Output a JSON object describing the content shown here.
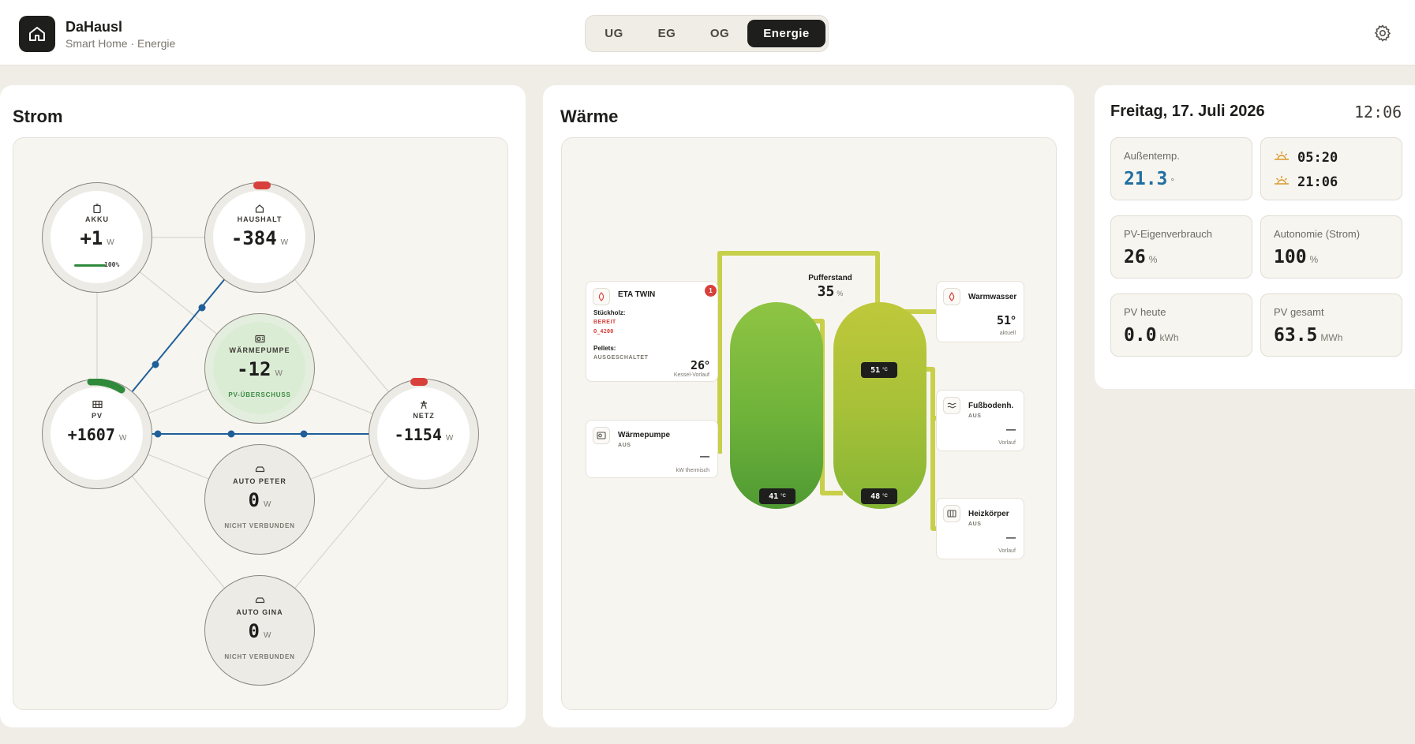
{
  "app": {
    "title": "DaHausl",
    "subtitle": "Smart Home · Energie",
    "logo_icon": "home-icon"
  },
  "nav": {
    "tabs": [
      "UG",
      "EG",
      "OG",
      "Energie"
    ],
    "active": "Energie"
  },
  "strom": {
    "title": "Strom",
    "nodes": {
      "akku": {
        "label": "AKKU",
        "value": "+1",
        "unit": "W",
        "soc": "100%",
        "icon": "battery-icon"
      },
      "haushalt": {
        "label": "HAUSHALT",
        "value": "-384",
        "unit": "W",
        "icon": "house-icon"
      },
      "waermepumpe": {
        "label": "WÄRMEPUMPE",
        "value": "-12",
        "unit": "W",
        "status": "PV-ÜBERSCHUSS",
        "icon": "heat-pump-icon"
      },
      "pv": {
        "label": "PV",
        "value": "+1607",
        "unit": "W",
        "icon": "solar-panel-icon"
      },
      "netz": {
        "label": "NETZ",
        "value": "-1154",
        "unit": "W",
        "icon": "grid-tower-icon"
      },
      "auto_peter": {
        "label": "AUTO PETER",
        "value": "0",
        "unit": "W",
        "status": "NICHT VERBUNDEN",
        "icon": "car-icon"
      },
      "auto_gina": {
        "label": "AUTO GINA",
        "value": "0",
        "unit": "W",
        "status": "NICHT VERBUNDEN",
        "icon": "car-icon"
      }
    }
  },
  "waerme": {
    "title": "Wärme",
    "eta": {
      "title": "ETA TWIN",
      "badge": "1",
      "stueckholz_label": "Stückholz:",
      "stueckholz_state": "BEREIT",
      "stueckholz_code": "O_4200",
      "pellets_label": "Pellets:",
      "pellets_state": "AUSGESCHALTET",
      "temp": "26",
      "temp_unit": "°",
      "temp_caption": "Kessel-Vorlauf"
    },
    "wp": {
      "title": "Wärmepumpe",
      "state": "AUS",
      "value": "—",
      "caption": "kW thermisch"
    },
    "puffer": {
      "label": "Pufferstand",
      "value": "35",
      "unit": "%"
    },
    "tanks": {
      "left_bottom": "41",
      "right_top": "51",
      "right_bottom": "48",
      "unit": "°C"
    },
    "warmwasser": {
      "title": "Warmwasser",
      "value": "51",
      "unit": "°",
      "caption": "aktuell"
    },
    "fussboden": {
      "title": "Fußbodenh.",
      "state": "AUS",
      "value": "—",
      "caption": "Vorlauf"
    },
    "heizkoerper": {
      "title": "Heizkörper",
      "state": "AUS",
      "value": "—",
      "caption": "Vorlauf"
    }
  },
  "info": {
    "date": "Freitag, 17. Juli 2026",
    "time": "12:06",
    "aussentemp": {
      "label": "Außentemp.",
      "value": "21.3",
      "unit": "°"
    },
    "sunrise": "05:20",
    "sunset": "21:06",
    "pv_eigen": {
      "label": "PV-Eigenverbrauch",
      "value": "26",
      "unit": "%"
    },
    "autonomie": {
      "label": "Autonomie (Strom)",
      "value": "100",
      "unit": "%"
    },
    "pv_heute": {
      "label": "PV heute",
      "value": "0.0",
      "unit": "kWh"
    },
    "pv_gesamt": {
      "label": "PV gesamt",
      "value": "63.5",
      "unit": "MWh"
    }
  },
  "colors": {
    "accent_dark": "#1e1e1c",
    "flow_blue": "#1f5f99",
    "pipe": "#c8cf4a",
    "red": "#d8403b",
    "green": "#2f8a3b",
    "temp_blue": "#1f6fa0"
  }
}
